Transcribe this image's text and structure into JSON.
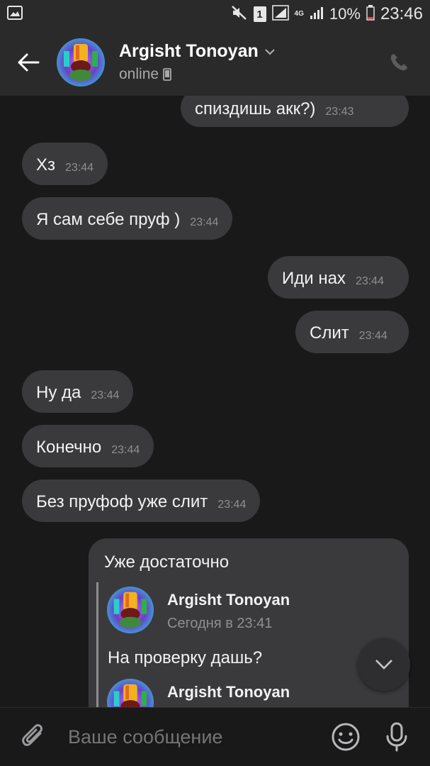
{
  "status_bar": {
    "sim": "1",
    "lte": "4G",
    "battery": "10%",
    "clock": "23:46"
  },
  "header": {
    "contact_name": "Argisht Tonoyan",
    "status": "online"
  },
  "messages": [
    {
      "side": "out",
      "text": "спиздишь акк?)",
      "time": "23:43"
    },
    {
      "side": "in",
      "text": "Хз",
      "time": "23:44"
    },
    {
      "side": "in",
      "text": "Я сам себе пруф )",
      "time": "23:44"
    },
    {
      "side": "out",
      "text": "Иди нах",
      "time": "23:44"
    },
    {
      "side": "out",
      "text": "Слит",
      "time": "23:44"
    },
    {
      "side": "in",
      "text": "Ну да",
      "time": "23:44"
    },
    {
      "side": "in",
      "text": "Конечно",
      "time": "23:44"
    },
    {
      "side": "in",
      "text": "Без пруфоф уже слит",
      "time": "23:44"
    }
  ],
  "forward_card": {
    "text": "Уже достаточно",
    "quotes": [
      {
        "author": "Argisht Tonoyan",
        "date": "Сегодня в 23:41",
        "text": "На проверку дашь?"
      },
      {
        "author": "Argisht Tonoyan"
      }
    ]
  },
  "composer": {
    "placeholder": "Ваше сообщение"
  },
  "colors": {
    "background": "#19191a",
    "bar": "#2a2a2b",
    "bubble": "#3a3a3c"
  }
}
